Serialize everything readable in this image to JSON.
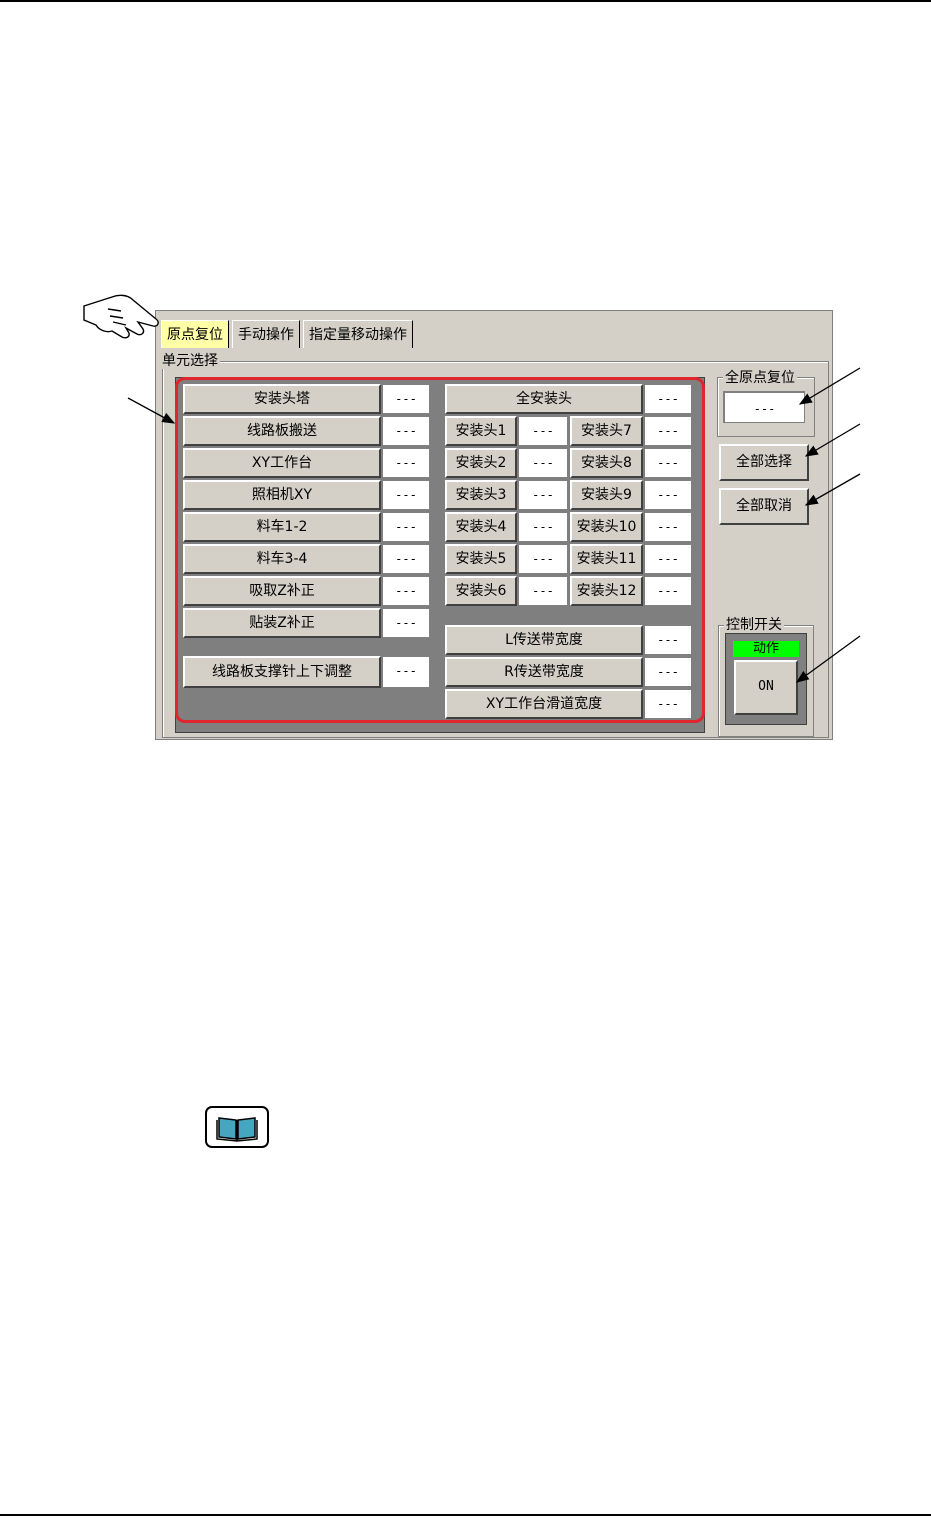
{
  "colors": {
    "tab_active": "#ffffa8",
    "frame_highlight": "#e0252c",
    "status_green": "#00ff00"
  },
  "tabs": [
    {
      "label": "原点复位",
      "active": true
    },
    {
      "label": "手动操作",
      "active": false
    },
    {
      "label": "指定量移动操作",
      "active": false
    }
  ],
  "unit_select": {
    "label": "单元选择",
    "left_units": [
      {
        "label": "安装头塔",
        "value": "---"
      },
      {
        "label": "线路板搬送",
        "value": "---"
      },
      {
        "label": "XY工作台",
        "value": "---"
      },
      {
        "label": "照相机XY",
        "value": "---"
      },
      {
        "label": "料车1-2",
        "value": "---"
      },
      {
        "label": "料车3-4",
        "value": "---"
      },
      {
        "label": "吸取Z补正",
        "value": "---"
      },
      {
        "label": "贴装Z补正",
        "value": "---"
      },
      {
        "label": "线路板支撑针上下调整",
        "value": "---"
      }
    ],
    "all_heads": {
      "label": "全安装头",
      "value": "---"
    },
    "heads": [
      {
        "label": "安装头1",
        "value": "---"
      },
      {
        "label": "安装头7",
        "value": "---"
      },
      {
        "label": "安装头2",
        "value": "---"
      },
      {
        "label": "安装头8",
        "value": "---"
      },
      {
        "label": "安装头3",
        "value": "---"
      },
      {
        "label": "安装头9",
        "value": "---"
      },
      {
        "label": "安装头4",
        "value": "---"
      },
      {
        "label": "安装头10",
        "value": "---"
      },
      {
        "label": "安装头5",
        "value": "---"
      },
      {
        "label": "安装头11",
        "value": "---"
      },
      {
        "label": "安装头6",
        "value": "---"
      },
      {
        "label": "安装头12",
        "value": "---"
      }
    ],
    "widths": [
      {
        "label": "L传送带宽度",
        "value": "---"
      },
      {
        "label": "R传送带宽度",
        "value": "---"
      },
      {
        "label": "XY工作台滑道宽度",
        "value": "---"
      }
    ]
  },
  "all_origin": {
    "label": "全原点复位",
    "value": "---"
  },
  "buttons": {
    "select_all": "全部选择",
    "cancel_all": "全部取消"
  },
  "control": {
    "label": "控制开关",
    "status": "动作",
    "switch": "ON"
  }
}
